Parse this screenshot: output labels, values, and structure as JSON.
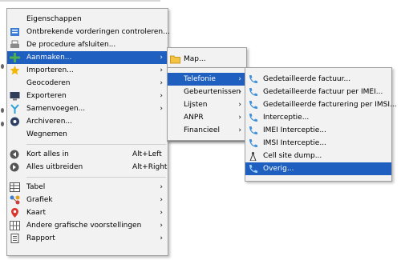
{
  "main_menu": {
    "items": [
      {
        "label": "Eigenschappen",
        "icon": "none"
      },
      {
        "label": "Ontbrekende vorderingen controleren...",
        "icon": "check-list-icon"
      },
      {
        "label": "De procedure afsluiten...",
        "icon": "printer-icon"
      },
      {
        "label": "Aanmaken...",
        "icon": "plus-icon",
        "submenu": true,
        "highlighted": true
      },
      {
        "label": "Importeren...",
        "icon": "star-icon",
        "submenu": true
      },
      {
        "label": "Geocoderen",
        "icon": "none",
        "submenu": true
      },
      {
        "label": "Exporteren",
        "icon": "monitor-icon",
        "submenu": true
      },
      {
        "label": "Samenvoegen...",
        "icon": "merge-icon",
        "submenu": true
      },
      {
        "label": "Archiveren...",
        "icon": "archive-icon"
      },
      {
        "label": "Wegnemen",
        "icon": "none"
      },
      {
        "label": "Kort alles in",
        "icon": "collapse-icon",
        "shortcut": "Alt+Left"
      },
      {
        "label": "Alles uitbreiden",
        "icon": "expand-icon",
        "shortcut": "Alt+Right"
      },
      {
        "label": "Tabel",
        "icon": "table-icon",
        "submenu": true
      },
      {
        "label": "Grafiek",
        "icon": "graph-icon",
        "submenu": true
      },
      {
        "label": "Kaart",
        "icon": "map-pin-icon",
        "submenu": true
      },
      {
        "label": "Andere grafische voorstellingen",
        "icon": "grid-icon",
        "submenu": true
      },
      {
        "label": "Rapport",
        "icon": "report-icon",
        "submenu": true
      }
    ]
  },
  "aanmaken_menu": {
    "items": [
      {
        "label": "Map...",
        "icon": "folder-icon"
      }
    ]
  },
  "category_menu": {
    "items": [
      {
        "label": "Telefonie",
        "submenu": true,
        "highlighted": true
      },
      {
        "label": "Gebeurtenissen",
        "submenu": true
      },
      {
        "label": "Lijsten",
        "submenu": true
      },
      {
        "label": "ANPR",
        "submenu": true
      },
      {
        "label": "Financieel",
        "submenu": true
      }
    ]
  },
  "telefonie_menu": {
    "items": [
      {
        "label": "Gedetailleerde factuur...",
        "icon": "phone-icon"
      },
      {
        "label": "Gedetailleerde factuur per IMEI...",
        "icon": "phone-icon"
      },
      {
        "label": "Gedetailleerde facturering per IMSI...",
        "icon": "phone-icon"
      },
      {
        "label": "Interceptie...",
        "icon": "phone-icon"
      },
      {
        "label": "IMEI Interceptie...",
        "icon": "phone-icon"
      },
      {
        "label": "IMSI Interceptie...",
        "icon": "phone-icon"
      },
      {
        "label": "Cell site dump...",
        "icon": "antenna-icon"
      },
      {
        "label": "Overig...",
        "icon": "phone-icon",
        "highlighted": true
      }
    ]
  },
  "arrow_glyph": "›",
  "colors": {
    "highlight": "#1e5fbf",
    "menu_bg": "#f2f2f2",
    "border": "#a0a0a0"
  }
}
